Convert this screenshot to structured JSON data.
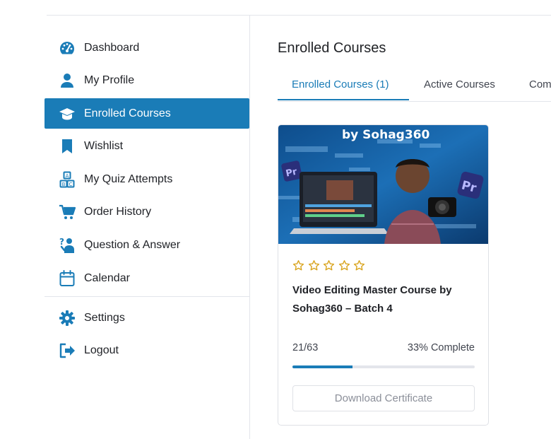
{
  "sidebar": {
    "items": [
      {
        "label": "Dashboard",
        "icon": "dashboard-icon"
      },
      {
        "label": "My Profile",
        "icon": "user-icon"
      },
      {
        "label": "Enrolled Courses",
        "icon": "graduation-cap-icon",
        "active": true
      },
      {
        "label": "Wishlist",
        "icon": "bookmark-icon"
      },
      {
        "label": "My Quiz Attempts",
        "icon": "quiz-icon"
      },
      {
        "label": "Order History",
        "icon": "cart-icon"
      },
      {
        "label": "Question & Answer",
        "icon": "question-answer-icon"
      },
      {
        "label": "Calendar",
        "icon": "calendar-icon"
      }
    ],
    "lower_items": [
      {
        "label": "Settings",
        "icon": "gear-icon"
      },
      {
        "label": "Logout",
        "icon": "logout-icon"
      }
    ]
  },
  "main": {
    "title": "Enrolled Courses",
    "tabs": [
      {
        "label": "Enrolled Courses (1)",
        "active": true
      },
      {
        "label": "Active Courses"
      },
      {
        "label": "Com"
      }
    ],
    "course": {
      "thumbnail_text": "by Sohag360",
      "thumbnail_badge": "Pr",
      "rating": 0,
      "rating_max": 5,
      "title": "Video Editing Master Course by Sohag360 – Batch 4",
      "lessons": "21/63",
      "percent_label": "33% Complete",
      "progress": 0.33,
      "download_label": "Download Certificate"
    }
  },
  "colors": {
    "accent": "#1a7cb7",
    "star": "#d9a520",
    "text": "#212327"
  }
}
